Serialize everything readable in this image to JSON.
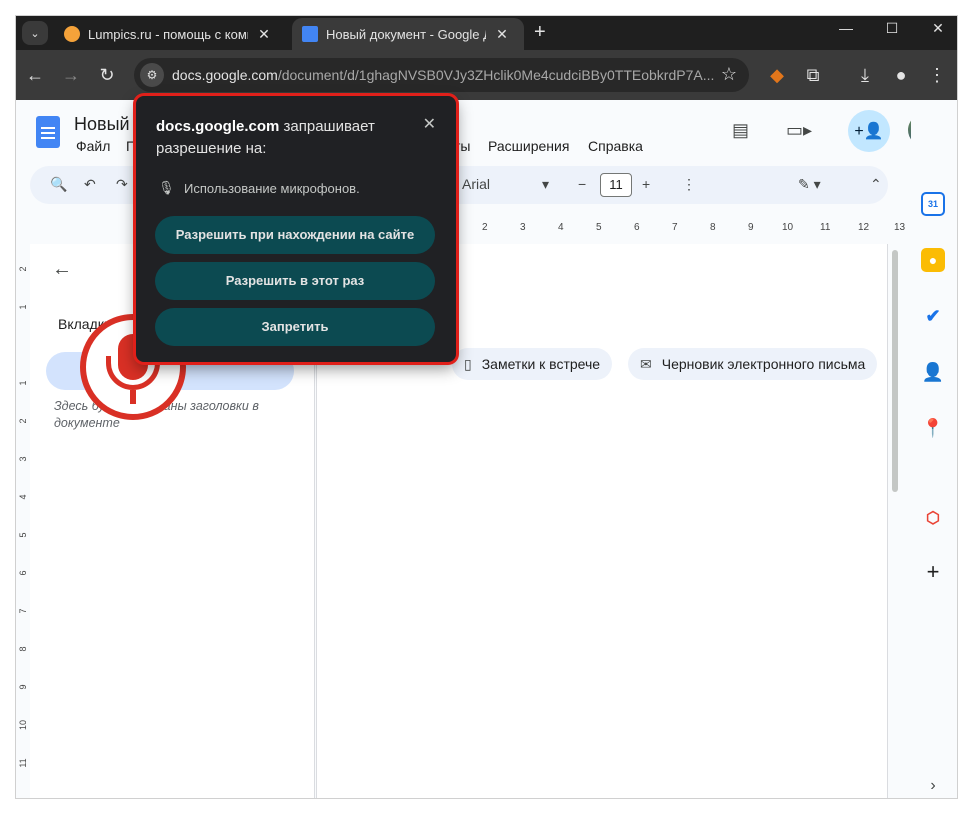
{
  "browser": {
    "tabs": [
      {
        "title": "Lumpics.ru - помощь с компьютером",
        "active": false
      },
      {
        "title": "Новый документ - Google Документы",
        "active": true
      }
    ],
    "new_tab": "+",
    "url_host": "docs.google.com",
    "url_path": "/document/d/1ghagNVSB0VJy3ZHclik0Me4cudciBBy0TTEobkrdP7A..."
  },
  "docs": {
    "title": "Новый",
    "menu": [
      "Файл",
      "П",
      "ты",
      "Расширения",
      "Справка"
    ],
    "font": "Arial",
    "font_size": "11",
    "ruler": [
      "2",
      "3",
      "4",
      "5",
      "6",
      "7",
      "8",
      "9",
      "10",
      "11",
      "12",
      "13"
    ],
    "vruler": [
      "2",
      "1",
      "1",
      "2",
      "3",
      "4",
      "5",
      "6",
      "7",
      "8",
      "9",
      "10",
      "11"
    ],
    "outline": {
      "tabs_label": "Вкладки до",
      "hint": "Здесь будут показаны заголовки в документе"
    },
    "chips": [
      {
        "label": "Заметки к встрече",
        "icon": "document-icon"
      },
      {
        "label": "Черновик электронного письма",
        "icon": "mail-icon"
      }
    ]
  },
  "permission_popup": {
    "site": "docs.google.com",
    "request_text": "запрашивает разрешение на:",
    "permission": "Использование микрофонов.",
    "buttons": {
      "allow_on_site": "Разрешить при нахождении на сайте",
      "allow_once": "Разрешить в этот раз",
      "deny": "Запретить"
    },
    "highlight_color": "#e0201a"
  },
  "colors": {
    "accent": "#0c4a51",
    "mic": "#d93025",
    "docs_blue": "#4285f4"
  }
}
